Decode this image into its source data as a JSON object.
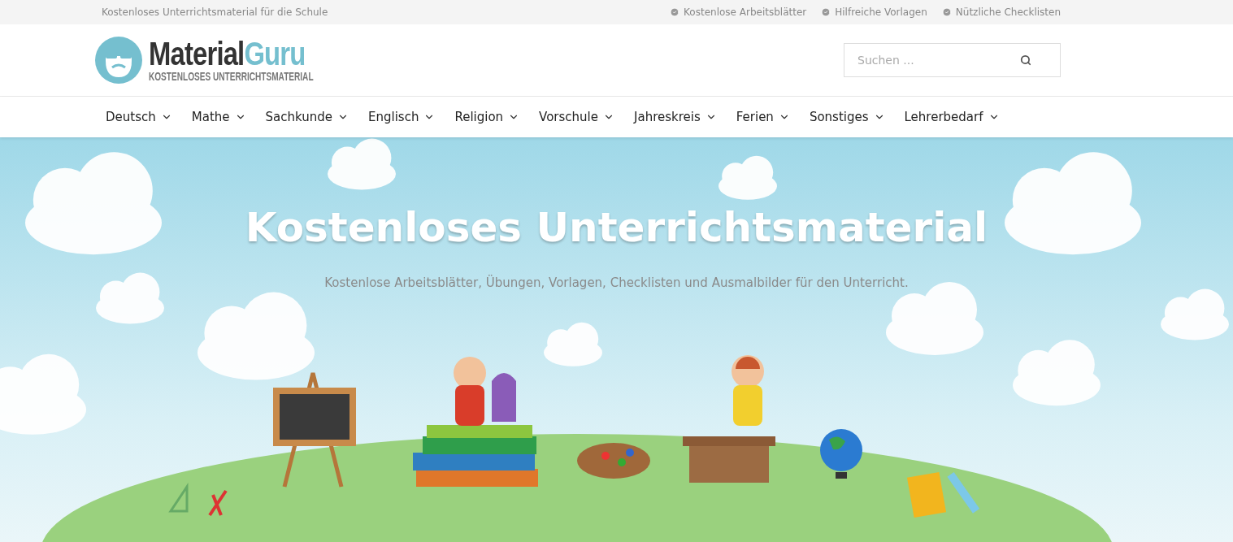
{
  "top_bar": {
    "tagline": "Kostenloses Unterrichtsmaterial für die Schule",
    "features": [
      "Kostenlose Arbeitsblätter",
      "Hilfreiche Vorlagen",
      "Nützliche Checklisten"
    ]
  },
  "logo": {
    "name_primary": "Material",
    "name_accent": "Guru",
    "subtitle": "KOSTENLOSES UNTERRICHTSMATERIAL"
  },
  "search": {
    "placeholder": "Suchen ..."
  },
  "nav": {
    "items": [
      "Deutsch",
      "Mathe",
      "Sachkunde",
      "Englisch",
      "Religion",
      "Vorschule",
      "Jahreskreis",
      "Ferien",
      "Sonstiges",
      "Lehrerbedarf"
    ]
  },
  "hero": {
    "title": "Kostenloses Unterrichtsmaterial",
    "subtitle": "Kostenlose Arbeitsblätter, Übungen, Vorlagen, Checklisten und Ausmalbilder für den Unterricht."
  }
}
